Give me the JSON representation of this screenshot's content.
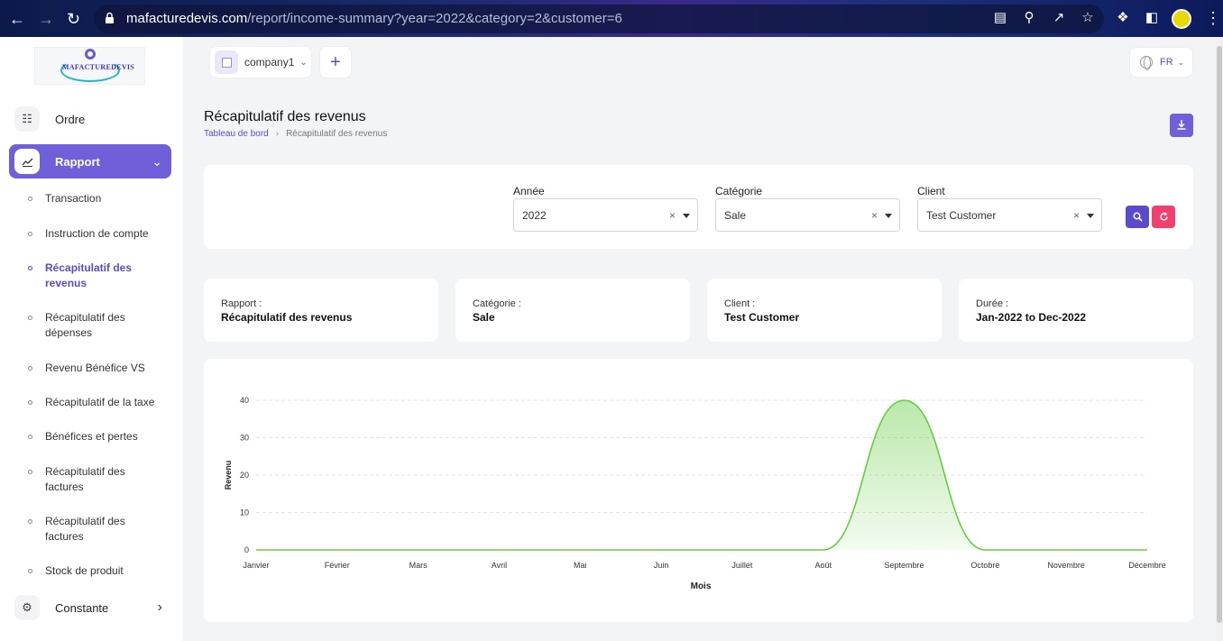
{
  "browser": {
    "url_host": "mafacturedevis.com",
    "url_path": "/report/income-summary?year=2022&category=2&customer=6"
  },
  "sidebar": {
    "logo_text": "MAFACTUREDEVIS",
    "items": [
      {
        "label": "Ordre",
        "icon": "cart-icon"
      },
      {
        "label": "Rapport",
        "icon": "chart-icon"
      },
      {
        "label": "Constante",
        "icon": "settings-icon"
      }
    ],
    "sub_items": [
      {
        "label": "Transaction"
      },
      {
        "label": "Instruction de compte"
      },
      {
        "label": "Récapitulatif des revenus"
      },
      {
        "label": "Récapitulatif des dépenses"
      },
      {
        "label": "Revenu Bénéfice VS"
      },
      {
        "label": "Récapitulatif de la taxe"
      },
      {
        "label": "Bénéfices et pertes"
      },
      {
        "label": "Récapitulatif des factures"
      },
      {
        "label": "Récapitulatif des factures"
      },
      {
        "label": "Stock de produit"
      }
    ]
  },
  "header": {
    "company_name": "company1",
    "language": "FR"
  },
  "page": {
    "title": "Récapitulatif des revenus",
    "breadcrumb_home": "Tableau de bord",
    "breadcrumb_current": "Récapitulatif des revenus"
  },
  "filters": {
    "year_label": "Année",
    "year_value": "2022",
    "category_label": "Catégorie",
    "category_value": "Sale",
    "client_label": "Client",
    "client_value": "Test Customer"
  },
  "info": {
    "report_label": "Rapport :",
    "report_value": "Récapitulatif des revenus",
    "category_label": "Catégorie :",
    "category_value": "Sale",
    "client_label": "Client :",
    "client_value": "Test Customer",
    "duration_label": "Durée :",
    "duration_value": "Jan-2022 to Dec-2022"
  },
  "colors": {
    "accent": "#6f5fd8",
    "reset": "#f23f6e",
    "series": "#66cc44"
  },
  "chart_data": {
    "type": "area",
    "categories": [
      "Janvier",
      "Février",
      "Mars",
      "Avril",
      "Mai",
      "Juin",
      "Juillet",
      "Août",
      "Septembre",
      "Octobre",
      "Novembre",
      "Décembre"
    ],
    "series": [
      {
        "values": [
          0,
          0,
          0,
          0,
          0,
          0,
          0,
          0,
          40,
          0,
          0,
          0
        ]
      }
    ],
    "xlabel": "Mois",
    "ylabel": "Revenu",
    "ylim": [
      0,
      40
    ],
    "yticks": [
      0,
      10,
      20,
      30,
      40
    ],
    "grid": true,
    "smooth": true
  }
}
